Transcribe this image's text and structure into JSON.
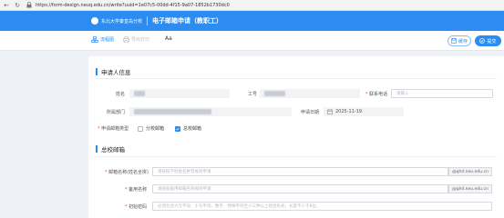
{
  "browser": {
    "url": "https://form-design.neuq.edu.cn/write?uuid=1e07c5-00dd-4f15-9a07-1852b1730dc0"
  },
  "header": {
    "org_name": "东北大学秦皇岛分校",
    "title": "电子邮箱申请（教职工）"
  },
  "toolbar": {
    "flow_label": "流程图",
    "print_label": "导出打印",
    "font_label": "Aa",
    "save_label": "缓存",
    "submit_label": "提交"
  },
  "applicant_section": {
    "title": "申请人信息",
    "name_label": "姓名",
    "name_value": "███",
    "staff_id_label": "工号",
    "staff_id_value": "██████",
    "phone_label": "联系电话",
    "phone_placeholder": "请输入",
    "dept_label": "所属部门",
    "dept_value": "██████████████████████",
    "date_label": "申请日期",
    "date_value": "2025-11-19",
    "mail_type_label": "申请邮箱类型",
    "mail_type_options": [
      "分校邮箱",
      "总校邮箱"
    ],
    "mail_type_checked": [
      false,
      true
    ]
  },
  "hq_section": {
    "title": "总校邮箱",
    "mailbox_name_label": "邮箱名称(姓名全拼)",
    "mailbox_name_placeholder": "请按照学校姓名拼音规则申请",
    "mailbox_name_suffix": "@qhd.neu.edu.cn",
    "backup_label": "备用名称",
    "backup_placeholder": "请按照备用邮箱名称规则申请",
    "backup_suffix": "@qhd.neu.edu.cn",
    "password_label": "初始密码",
    "password_placeholder": "必须包含大写字母、小写字母、数字、特殊字符至少三种以上组合形式，长度不少于8位。"
  }
}
